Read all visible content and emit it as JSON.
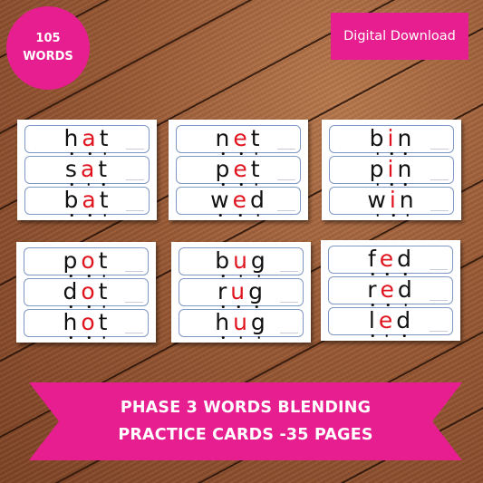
{
  "badge": {
    "line1": "105",
    "line2": "WORDS"
  },
  "tag": {
    "label": "Digital Download"
  },
  "colors": {
    "accent": "#e61e8f",
    "vowel": "#e0141e",
    "letter": "#111111",
    "strip_border": "#7f98c4"
  },
  "cards": [
    {
      "vowel": "a",
      "words": [
        [
          "h",
          "a",
          "t"
        ],
        [
          "s",
          "a",
          "t"
        ],
        [
          "b",
          "a",
          "t"
        ]
      ]
    },
    {
      "vowel": "e",
      "words": [
        [
          "n",
          "e",
          "t"
        ],
        [
          "p",
          "e",
          "t"
        ],
        [
          "w",
          "e",
          "d"
        ]
      ]
    },
    {
      "vowel": "i",
      "words": [
        [
          "b",
          "i",
          "n"
        ],
        [
          "p",
          "i",
          "n"
        ],
        [
          "w",
          "i",
          "n"
        ]
      ]
    },
    {
      "vowel": "o",
      "words": [
        [
          "p",
          "o",
          "t"
        ],
        [
          "d",
          "o",
          "t"
        ],
        [
          "h",
          "o",
          "t"
        ]
      ]
    },
    {
      "vowel": "u",
      "words": [
        [
          "b",
          "u",
          "g"
        ],
        [
          "r",
          "u",
          "g"
        ],
        [
          "h",
          "u",
          "g"
        ]
      ]
    },
    {
      "vowel": "e",
      "words": [
        [
          "f",
          "e",
          "d"
        ],
        [
          "r",
          "e",
          "d"
        ],
        [
          "l",
          "e",
          "d"
        ]
      ]
    }
  ],
  "banner": {
    "line1": "PHASE 3 WORDS BLENDING",
    "line2": "PRACTICE CARDS -35 PAGES"
  }
}
